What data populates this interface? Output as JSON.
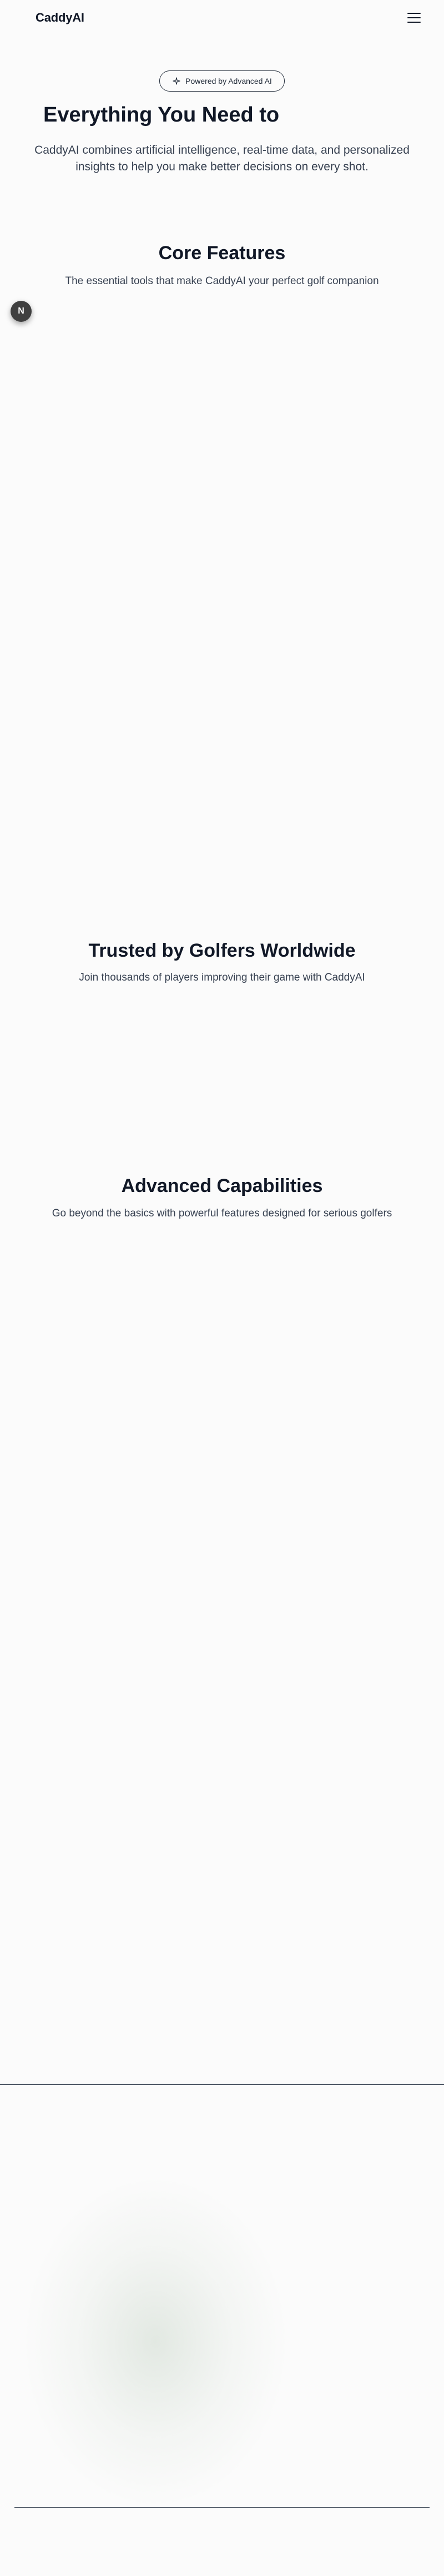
{
  "header": {
    "brand": "CaddyAI",
    "menu_icon": "hamburger-menu-icon"
  },
  "hero": {
    "badge_icon": "sparkle-icon",
    "badge_label": "Powered by Advanced AI",
    "title": "Everything You Need to",
    "subtitle": "CaddyAI combines artificial intelligence, real-time data, and personalized insights to help you make better decisions on every shot."
  },
  "fab": {
    "label": "N"
  },
  "core_features": {
    "title": "Core Features",
    "subtitle": "The essential tools that make CaddyAI your perfect golf companion"
  },
  "trusted": {
    "title": "Trusted by Golfers Worldwide",
    "subtitle": "Join thousands of players improving their game with CaddyAI"
  },
  "advanced": {
    "title": "Advanced Capabilities",
    "subtitle": "Go beyond the basics with powerful features designed for serious golfers"
  },
  "colors": {
    "background": "#fbfbfb",
    "text_primary": "#111827",
    "text_secondary": "#374151",
    "fab_background": "#3f3f3f"
  }
}
